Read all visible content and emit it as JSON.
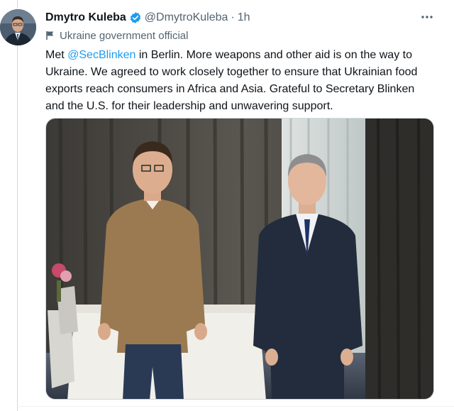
{
  "tweet": {
    "author": {
      "display_name": "Dmytro Kuleba",
      "handle": "@DmytroKuleba",
      "verified_icon": "verified-badge-icon",
      "verified_color": "#1d9bf0"
    },
    "separator": "·",
    "time": "1h",
    "account_label": "Ukraine government official",
    "text": {
      "before": "Met ",
      "mention": "@SecBlinken",
      "after": " in Berlin. More weapons and other aid is on the way to Ukraine. We agreed to work closely together to ensure that Ukrainian food exports reach consumers in Africa and Asia. Grateful to Secretary Blinken and the U.S. for their leadership and unwavering support."
    },
    "media": {
      "type": "photo"
    }
  },
  "colors": {
    "text": "#0f1419",
    "secondary": "#536471",
    "link": "#1d9bf0"
  }
}
